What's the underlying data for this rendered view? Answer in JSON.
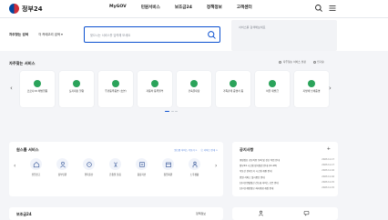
{
  "header": {
    "logo_text": "정부24",
    "nav": [
      "MyGOV",
      "민원서비스",
      "보조금24",
      "정책정보",
      "고객센터"
    ],
    "icons": [
      "search-icon",
      "menu-icon"
    ]
  },
  "search": {
    "label": "자주찾는 검색",
    "select_value": "각 카테고리 검색 ▾",
    "placeholder": "찾으시는 서비스를 입력해 보세요"
  },
  "side_card": {
    "text": "서비스를 검색해보세요"
  },
  "frequent": {
    "title": "자주찾는 서비스",
    "option_1": "자주찾는 서비스 설정",
    "option_2": "인기순",
    "cards": [
      {
        "label": "코로나19 예방접종"
      },
      {
        "label": "토지대장 열람"
      },
      {
        "label": "주민등록등본 (초본)"
      },
      {
        "label": "자동차 등록원부"
      },
      {
        "label": "건축물대장"
      },
      {
        "label": "가족관계 증명서 등"
      },
      {
        "label": "여권 재발급"
      },
      {
        "label": "지방세 납세증명"
      }
    ]
  },
  "oneclick": {
    "title": "원스톱 서비스",
    "link_1": "원스톱 서비스 더보기 >",
    "link_2": "ⓘ 서비스 안내 >",
    "items": [
      {
        "label": "전입신고",
        "icon": "house-icon"
      },
      {
        "label": "정부민원",
        "icon": "person-icon"
      },
      {
        "label": "행복출산",
        "icon": "baby-icon"
      },
      {
        "label": "온종일 돌봄",
        "icon": "ribbon-icon"
      },
      {
        "label": "중장기인",
        "icon": "book-icon"
      },
      {
        "label": "창업지원",
        "icon": "calendar-icon"
      },
      {
        "label": "노후생활",
        "icon": "elder-icon"
      }
    ]
  },
  "notice": {
    "title": "공지사항",
    "more": "+",
    "items": [
      {
        "title": "행정정보 공동이용 동의 및 전산 작업 안내",
        "date": "2023.11.17"
      },
      {
        "title": "정부24 시스템 정기점검 안내 (11.18)",
        "date": "2023.11.17"
      },
      {
        "title": "부동산 전자등기 시스템 개편 안내",
        "date": "2023.11.16"
      },
      {
        "title": "민원 서비스 일시중단 안내",
        "date": "2023.11.16"
      },
      {
        "title": "[공지] 연말정산 간소화 서비스 오픈 안내",
        "date": "2023.11.15"
      },
      {
        "title": "[공지] 개인정보 처리방침 개정 안내",
        "date": "2023.11.15"
      }
    ]
  },
  "bogo": {
    "title": "보조금24",
    "link": "정책정보"
  }
}
